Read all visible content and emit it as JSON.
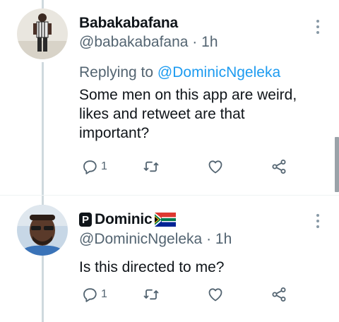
{
  "tweets": [
    {
      "display_name": "Babakabafana",
      "handle": "@babakabafana",
      "separator": "·",
      "time": "1h",
      "replying_prefix": "Replying to",
      "replying_to": "@DominicNgeleka",
      "text_lines": [
        "Some men on this app are weird,",
        "likes and retweet are that",
        "important?"
      ],
      "reply_count": "1",
      "icons": [
        "reply-icon",
        "retweet-icon",
        "like-icon",
        "share-icon",
        "more-icon"
      ]
    },
    {
      "name_badge": "P",
      "display_name": "Dominic",
      "flag": "south-africa-flag",
      "handle": "@DominicNgeleka",
      "separator": "·",
      "time": "1h",
      "text_lines": [
        "Is this directed to me?"
      ],
      "reply_count": "1",
      "icons": [
        "reply-icon",
        "retweet-icon",
        "like-icon",
        "share-icon",
        "more-icon"
      ]
    }
  ],
  "colors": {
    "text": "#0f1419",
    "secondary": "#536471",
    "link": "#1d9bf0",
    "thread_line": "#cfd9de"
  }
}
